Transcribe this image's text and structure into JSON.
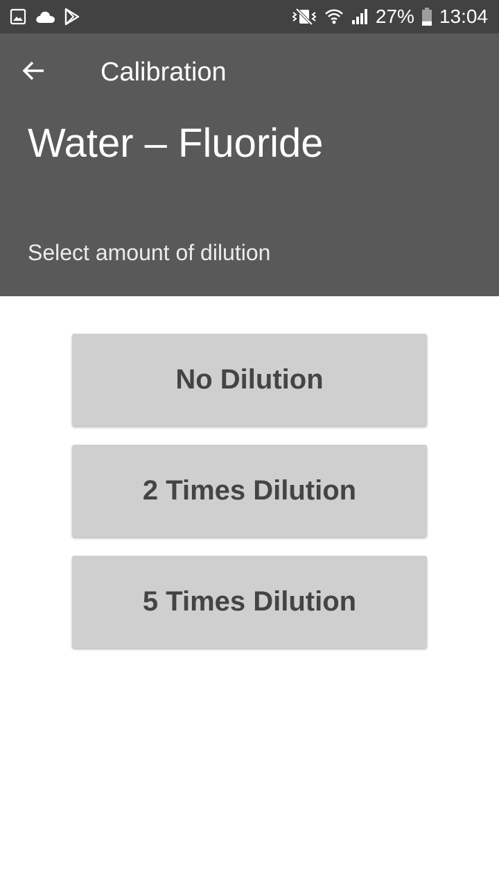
{
  "status_bar": {
    "battery_percent": "27%",
    "time": "13:04",
    "left_icons": [
      "image-icon",
      "cloud-icon",
      "play-store-icon"
    ],
    "right_icons": [
      "vibrate-mute-icon",
      "wifi-icon",
      "signal-icon",
      "battery-icon"
    ],
    "battery_level": 0.27
  },
  "toolbar": {
    "back_icon": "arrow-left-icon",
    "title": "Calibration"
  },
  "header": {
    "test_name": "Water – Fluoride",
    "subtitle": "Select amount of dilution"
  },
  "dilution_options": [
    "No Dilution",
    "2 Times Dilution",
    "5 Times Dilution"
  ],
  "colors": {
    "status_bar_bg": "#424242",
    "header_bg": "#595959",
    "button_bg": "#cfcfcf",
    "button_text": "#444444",
    "page_bg": "#ffffff"
  }
}
